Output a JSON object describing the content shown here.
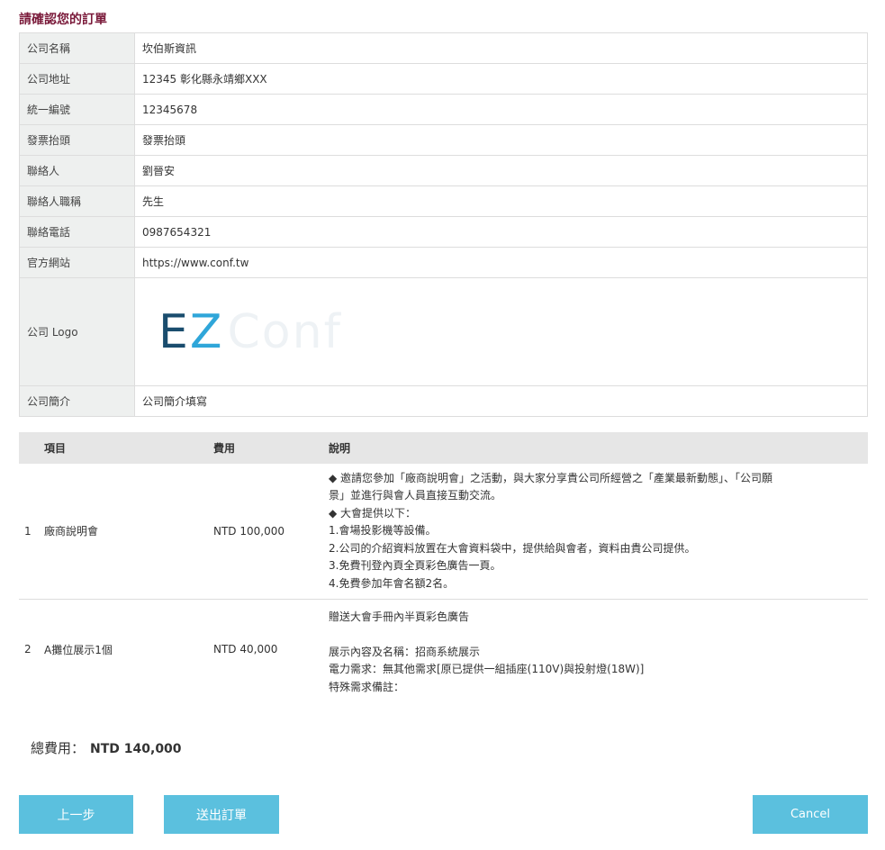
{
  "page_title": "請確認您的訂單",
  "company": {
    "rows": [
      {
        "label": "公司名稱",
        "value": "坎伯斯資訊"
      },
      {
        "label": "公司地址",
        "value": "12345  彰化縣永靖鄉XXX"
      },
      {
        "label": "統一編號",
        "value": "12345678"
      },
      {
        "label": "發票抬頭",
        "value": "發票抬頭"
      },
      {
        "label": "聯絡人",
        "value": "劉晉安"
      },
      {
        "label": "聯絡人職稱",
        "value": "先生"
      },
      {
        "label": "聯絡電話",
        "value": "0987654321"
      },
      {
        "label": "官方網站",
        "value": "https://www.conf.tw"
      }
    ],
    "logo_label": "公司 Logo",
    "logo_text": {
      "e": "E",
      "z": "Z",
      "rest": "Conf"
    },
    "intro_label": "公司簡介",
    "intro_value": "公司簡介填寫"
  },
  "items": {
    "headers": {
      "item": "項目",
      "fee": "費用",
      "desc": "說明"
    },
    "rows": [
      {
        "no": "1",
        "name": "廠商說明會",
        "fee": "NTD 100,000",
        "desc_lines": [
          "◆ 邀請您參加「廠商說明會」之活動，與大家分享貴公司所經營之「產業最新動態」、「公司願",
          "景」並進行與會人員直接互動交流。",
          "◆ 大會提供以下：",
          "1.會場投影機等設備。",
          "2.公司的介紹資料放置在大會資料袋中，提供給與會者，資料由貴公司提供。",
          "3.免費刊登內頁全頁彩色廣告一頁。",
          "4.免費參加年會名額2名。"
        ]
      },
      {
        "no": "2",
        "name": "A攤位展示1個",
        "fee": "NTD 40,000",
        "desc_lines": [
          "贈送大會手冊內半頁彩色廣告",
          "",
          "展示內容及名稱：招商系統展示",
          "電力需求：無其他需求[原已提供一組插座(110V)與投射燈(18W)]",
          "特殊需求備註："
        ]
      }
    ]
  },
  "total": {
    "label": "總費用：",
    "value": "NTD 140,000"
  },
  "buttons": {
    "prev": "上一步",
    "submit": "送出訂單",
    "cancel": "Cancel"
  },
  "colors": {
    "title": "#7a1a3a",
    "button": "#5bc0de",
    "label_bg": "#eef0ef",
    "header_bg": "#e6e6e6"
  }
}
